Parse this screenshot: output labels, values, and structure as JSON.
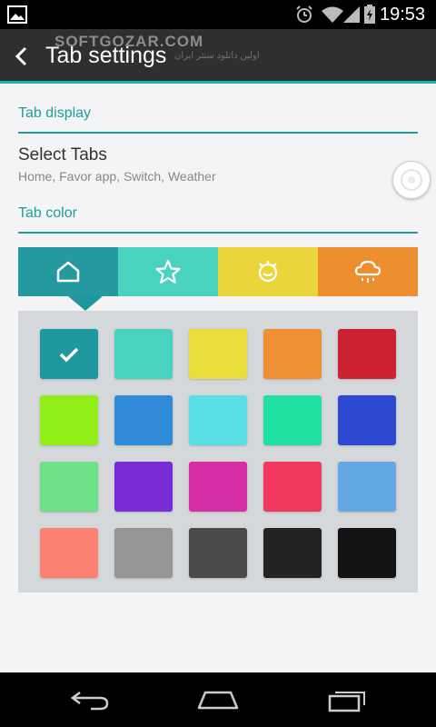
{
  "status_bar": {
    "time": "19:53",
    "icons": [
      "gallery-icon",
      "alarm-icon",
      "wifi-icon",
      "signal-icon",
      "battery-icon"
    ]
  },
  "watermark": {
    "text": "SOFTGOZAR.COM",
    "subtext": "اولین دانلود سنتر ایران"
  },
  "action_bar": {
    "title": "Tab settings",
    "back_icon": "back-chevron-icon",
    "accent": "#1fb3ad"
  },
  "tab_display": {
    "header": "Tab display",
    "select_tabs": {
      "title": "Select Tabs",
      "summary": "Home, Favor app, Switch, Weather"
    }
  },
  "tab_color": {
    "header": "Tab color",
    "tabs": [
      {
        "icon": "home-icon",
        "color": "#2599a0"
      },
      {
        "icon": "star-icon",
        "color": "#49d3bf"
      },
      {
        "icon": "switch-icon",
        "color": "#ead63b"
      },
      {
        "icon": "weather-icon",
        "color": "#ee8f2f"
      }
    ],
    "palette": [
      [
        "#1f979e",
        "#49d3bf",
        "#e9de3c",
        "#ee8f34",
        "#cd2230"
      ],
      [
        "#91ee17",
        "#2f8bd8",
        "#5bdfe6",
        "#20e1a1",
        "#2d49d2"
      ],
      [
        "#6fe088",
        "#7a2bd8",
        "#d82ea5",
        "#f2395d",
        "#62a9e4"
      ],
      [
        "#fb8273",
        "#959595",
        "#4a4a4a",
        "#232323",
        "#131313"
      ]
    ],
    "selected": {
      "row": 0,
      "col": 0
    },
    "selected_icon": "checkmark-icon"
  },
  "nav_bar": {
    "buttons": [
      "back-icon",
      "home-icon",
      "recents-icon"
    ]
  }
}
